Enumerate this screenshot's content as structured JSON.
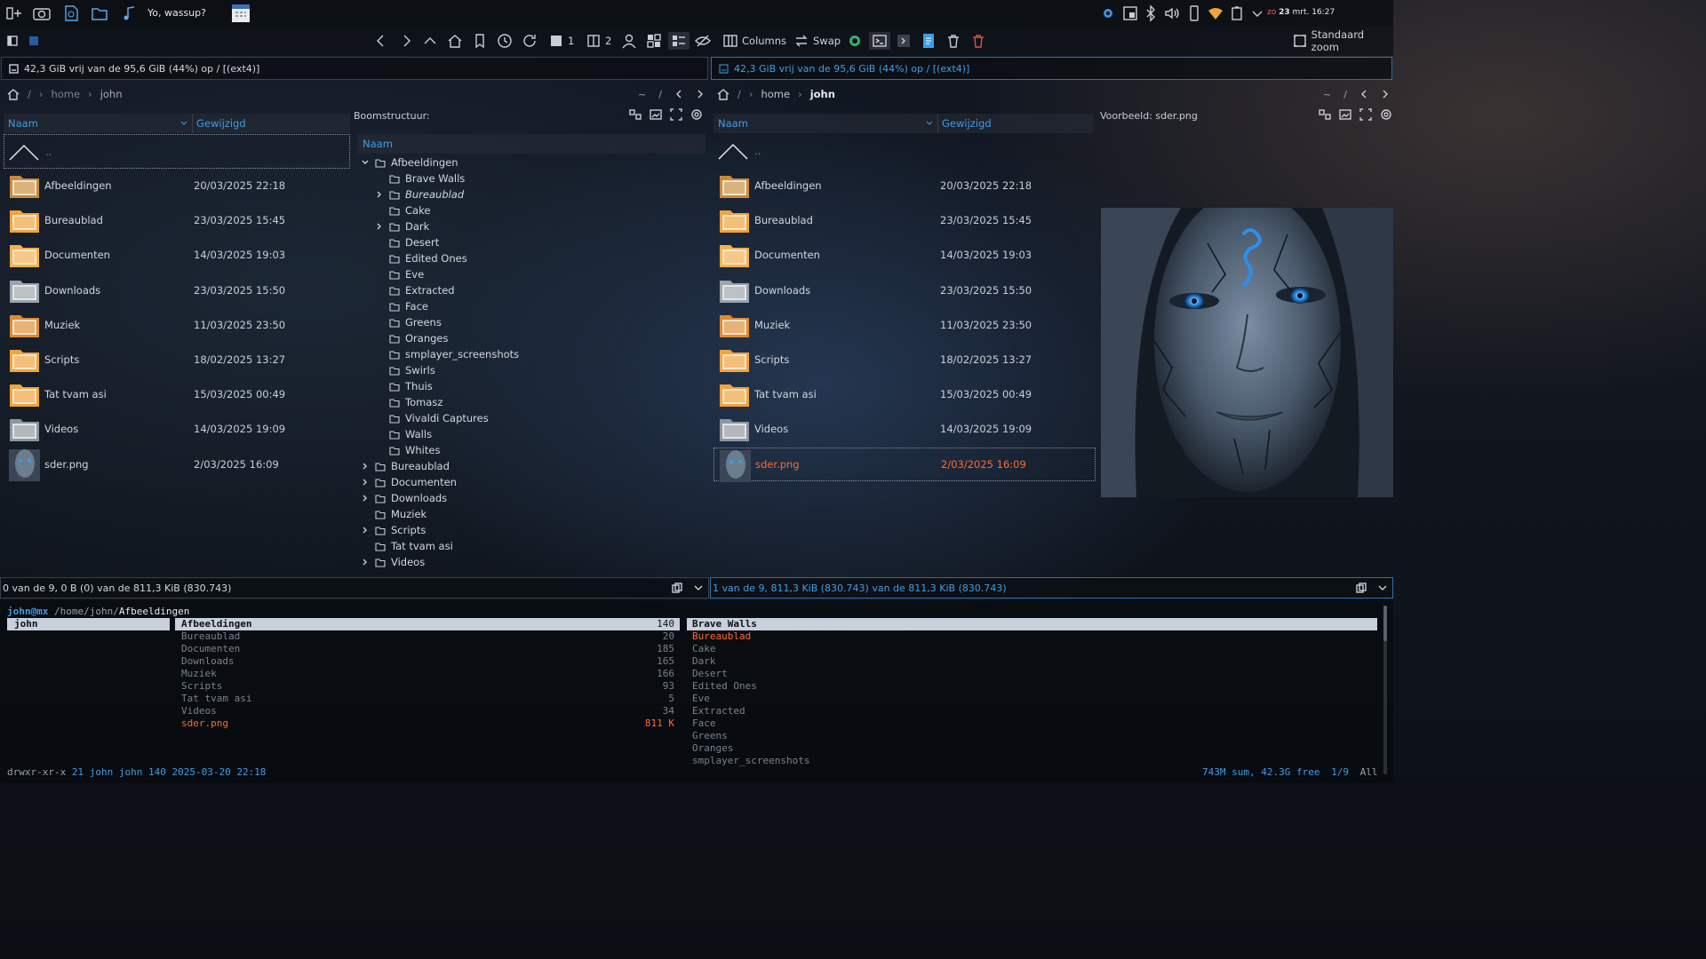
{
  "topbar": {
    "greeting": "Yo, wassup?",
    "clock_day": "zo",
    "clock_date": "23",
    "clock_rest": "mrt. 16:27"
  },
  "toolbar": {
    "tab1": "1",
    "tab2": "2",
    "columns": "Columns",
    "swap": "Swap",
    "zoom": "Standaard zoom"
  },
  "left": {
    "drive": "42,3 GiB vrij van de 95,6 GiB (44%) op / [(ext4)]",
    "crumbs": [
      "/",
      "home",
      "john"
    ],
    "nav": [
      "~",
      "/"
    ],
    "col_name": "Naam",
    "col_modified": "Gewijzigd",
    "parent": "..",
    "files": [
      {
        "name": "Afbeeldingen",
        "date": "20/03/2025 22:18",
        "icon": "folder-pictures-icon"
      },
      {
        "name": "Bureaublad",
        "date": "23/03/2025 15:45",
        "icon": "folder-desktop-icon"
      },
      {
        "name": "Documenten",
        "date": "14/03/2025 19:03",
        "icon": "folder-documents-icon"
      },
      {
        "name": "Downloads",
        "date": "23/03/2025 15:50",
        "icon": "folder-downloads-icon"
      },
      {
        "name": "Muziek",
        "date": "11/03/2025 23:50",
        "icon": "folder-music-icon"
      },
      {
        "name": "Scripts",
        "date": "18/02/2025 13:27",
        "icon": "folder-scripts-icon"
      },
      {
        "name": "Tat tvam asi",
        "date": "15/03/2025 00:49",
        "icon": "folder-fonts-icon"
      },
      {
        "name": "Videos",
        "date": "14/03/2025 19:09",
        "icon": "folder-videos-icon"
      },
      {
        "name": "sder.png",
        "date": "2/03/2025 16:09",
        "icon": "image-thumbnail-icon"
      }
    ],
    "status": "0 van de 9, 0 B (0) van de 811,3 KiB (830.743)"
  },
  "tree": {
    "title": "Boomstructuur:",
    "col_name": "Naam",
    "items": [
      {
        "label": "Afbeeldingen",
        "depth": 0,
        "exp": "open"
      },
      {
        "label": "Brave Walls",
        "depth": 1,
        "exp": ""
      },
      {
        "label": "Bureaublad",
        "depth": 1,
        "exp": "closed",
        "italic": true
      },
      {
        "label": "Cake",
        "depth": 1,
        "exp": ""
      },
      {
        "label": "Dark",
        "depth": 1,
        "exp": "closed"
      },
      {
        "label": "Desert",
        "depth": 1,
        "exp": ""
      },
      {
        "label": "Edited Ones",
        "depth": 1,
        "exp": ""
      },
      {
        "label": "Eve",
        "depth": 1,
        "exp": ""
      },
      {
        "label": "Extracted",
        "depth": 1,
        "exp": ""
      },
      {
        "label": "Face",
        "depth": 1,
        "exp": ""
      },
      {
        "label": "Greens",
        "depth": 1,
        "exp": ""
      },
      {
        "label": "Oranges",
        "depth": 1,
        "exp": ""
      },
      {
        "label": "smplayer_screenshots",
        "depth": 1,
        "exp": ""
      },
      {
        "label": "Swirls",
        "depth": 1,
        "exp": ""
      },
      {
        "label": "Thuis",
        "depth": 1,
        "exp": ""
      },
      {
        "label": "Tomasz",
        "depth": 1,
        "exp": ""
      },
      {
        "label": "Vivaldi Captures",
        "depth": 1,
        "exp": ""
      },
      {
        "label": "Walls",
        "depth": 1,
        "exp": ""
      },
      {
        "label": "Whites",
        "depth": 1,
        "exp": ""
      },
      {
        "label": "Bureaublad",
        "depth": 0,
        "exp": "closed"
      },
      {
        "label": "Documenten",
        "depth": 0,
        "exp": "closed"
      },
      {
        "label": "Downloads",
        "depth": 0,
        "exp": "closed"
      },
      {
        "label": "Muziek",
        "depth": 0,
        "exp": ""
      },
      {
        "label": "Scripts",
        "depth": 0,
        "exp": "closed"
      },
      {
        "label": "Tat tvam asi",
        "depth": 0,
        "exp": ""
      },
      {
        "label": "Videos",
        "depth": 0,
        "exp": "closed"
      }
    ]
  },
  "right": {
    "drive": "42,3 GiB vrij van de 95,6 GiB (44%) op / [(ext4)]",
    "crumbs": [
      "/",
      "home",
      "john"
    ],
    "nav": [
      "~",
      "/"
    ],
    "col_name": "Naam",
    "col_modified": "Gewijzigd",
    "parent": "..",
    "selected": "sder.png",
    "status": "1 van de 9, 811,3 KiB (830.743) van de 811,3 KiB (830.743)",
    "preview_title": "Voorbeeld: sder.png"
  },
  "term": {
    "prompt_user": "john@mx",
    "prompt_path": "/home/john/",
    "prompt_dir": "Afbeeldingen",
    "col1": [
      "john"
    ],
    "col2": [
      {
        "n": "Afbeeldingen",
        "s": "140",
        "t": "sel"
      },
      {
        "n": "Bureaublad",
        "s": "20",
        "t": ""
      },
      {
        "n": "Documenten",
        "s": "185",
        "t": ""
      },
      {
        "n": "Downloads",
        "s": "165",
        "t": ""
      },
      {
        "n": "Muziek",
        "s": "166",
        "t": ""
      },
      {
        "n": "Scripts",
        "s": "93",
        "t": ""
      },
      {
        "n": "Tat tvam asi",
        "s": "5",
        "t": ""
      },
      {
        "n": "Videos",
        "s": "34",
        "t": ""
      },
      {
        "n": "sder.png",
        "s": "811 K",
        "t": "file"
      }
    ],
    "col3": [
      {
        "n": "Brave Walls",
        "t": "sel"
      },
      {
        "n": "Bureaublad",
        "t": "hl"
      },
      {
        "n": "Cake",
        "t": ""
      },
      {
        "n": "Dark",
        "t": ""
      },
      {
        "n": "Desert",
        "t": ""
      },
      {
        "n": "Edited Ones",
        "t": ""
      },
      {
        "n": "Eve",
        "t": ""
      },
      {
        "n": "Extracted",
        "t": ""
      },
      {
        "n": "Face",
        "t": ""
      },
      {
        "n": "Greens",
        "t": ""
      },
      {
        "n": "Oranges",
        "t": ""
      },
      {
        "n": "smplayer_screenshots",
        "t": ""
      }
    ],
    "perm": "drwxr-xr-x",
    "links": "21",
    "owner": "john john",
    "size": "140",
    "mtime": "2025-03-20 22:18",
    "sum": "743M sum, 42.3G free",
    "pos": "1/9",
    "all": "All"
  },
  "colors": {
    "accent": "#3d9ee5",
    "selection": "#ff6a2b",
    "folder": "#f2a33a"
  }
}
